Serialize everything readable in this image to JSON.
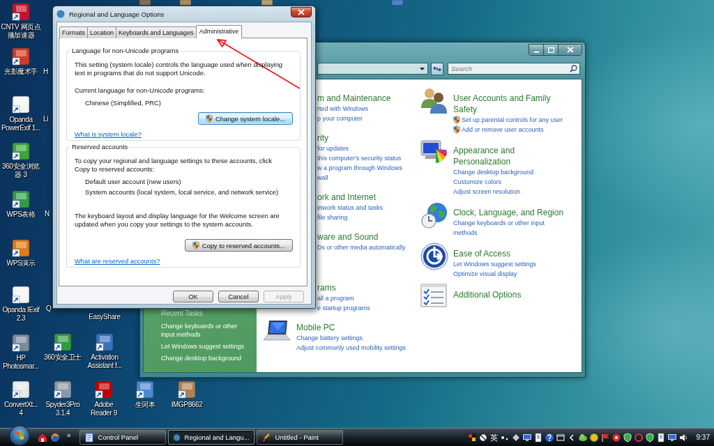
{
  "desktop": {
    "shortcuts": [
      {
        "kind": "full",
        "label": "CNTV 网页点播加速器"
      },
      {
        "kind": "full",
        "label": "光影魔术手"
      },
      {
        "kind": "full",
        "label": "Opanda PowerExif 1..."
      },
      {
        "kind": "full",
        "label": "360安全浏览器 3"
      },
      {
        "kind": "full",
        "label": "WPS表格"
      },
      {
        "kind": "full",
        "label": "WPS演示"
      },
      {
        "kind": "full",
        "label": "Opanda IExif 2.3"
      },
      {
        "kind": "full",
        "label": "HP Photosmar..."
      },
      {
        "kind": "full",
        "label": "ConvertXt... 4"
      },
      {
        "kind": "cut",
        "label": "H"
      },
      {
        "kind": "cut",
        "label": "Li"
      },
      {
        "kind": "cut",
        "label": "N"
      },
      {
        "kind": "cut",
        "label": "Q"
      },
      {
        "kind": "full",
        "label": "360安全卫士"
      },
      {
        "kind": "full",
        "label": "Spyder3Pro 3.1.4"
      },
      {
        "kind": "label_only",
        "label": "EasyShare"
      },
      {
        "kind": "full",
        "label": "Activation Assistant f..."
      },
      {
        "kind": "full",
        "label": "Adobe Reader 9"
      },
      {
        "kind": "full",
        "label": "生词本"
      },
      {
        "kind": "full",
        "label": "IMGP8662"
      },
      {
        "kind": "icon_only"
      },
      {
        "kind": "icon_only"
      },
      {
        "kind": "icon_only"
      },
      {
        "kind": "icon_only"
      }
    ]
  },
  "dialog": {
    "title": "Regional and Language Options",
    "tabs": [
      {
        "label": "Formats",
        "selected": false
      },
      {
        "label": "Location",
        "selected": false
      },
      {
        "label": "Keyboards and Languages",
        "selected": false
      },
      {
        "label": "Administrative",
        "selected": true
      }
    ],
    "groups": [
      {
        "title": "Language for non-Unicode programs",
        "items": [
          {
            "kind": "paragraph",
            "text": "This setting (system locale) controls the language used when displaying text in programs that do not support Unicode."
          },
          {
            "kind": "paragraph",
            "text": "Current language for non-Unicode programs:"
          },
          {
            "kind": "indented",
            "text": "Chinese (Simplified, PRC)"
          },
          {
            "kind": "button",
            "text": "Change system locale...",
            "admin_shield": true,
            "default": true
          },
          {
            "kind": "link",
            "text": "What is system locale?"
          }
        ]
      },
      {
        "title": "Reserved accounts",
        "items": [
          {
            "kind": "paragraph",
            "text": "To copy your regional and language settings to these accounts, click Copy to reserved accounts:"
          },
          {
            "kind": "indented",
            "text": "Default user account (new users)"
          },
          {
            "kind": "indented",
            "text": "System accounts (local system, local service, and network service)"
          },
          {
            "kind": "paragraph",
            "text": "The keyboard layout and display language for the Welcome screen are updated when you copy your settings to the system accounts."
          },
          {
            "kind": "button",
            "text": "Copy to reserved accounts...",
            "admin_shield": true,
            "default": false
          },
          {
            "kind": "link",
            "text": "What are reserved accounts?"
          }
        ]
      }
    ],
    "buttons": [
      {
        "label": "OK",
        "disabled": false
      },
      {
        "label": "Cancel",
        "disabled": false
      },
      {
        "label": "Apply",
        "disabled": true
      }
    ]
  },
  "control_panel": {
    "search": {
      "placeholder": "Search"
    },
    "recent_tasks": {
      "title": "Recent Tasks",
      "links": [
        "Change keyboards or other input methods",
        "Let Windows suggest settings",
        "Change desktop background"
      ]
    },
    "left_categories": [
      {
        "kind": "cut",
        "heading": "m and Maintenance",
        "links": [
          "rted with Windows",
          "p your computer"
        ]
      },
      {
        "kind": "cut",
        "heading": "rity",
        "links": [
          "for updates",
          "this computer's security status",
          "w a program through Windows",
          "wall"
        ]
      },
      {
        "kind": "cut",
        "heading": "ork and Internet",
        "links": [
          "etwork status and tasks",
          "file sharing"
        ]
      },
      {
        "kind": "cut",
        "heading": "ware and Sound",
        "links": [
          "Ds or other media automatically"
        ]
      },
      {
        "kind": "cut",
        "heading": "rams",
        "links": [
          "all a program",
          "e startup programs"
        ]
      },
      {
        "kind": "full",
        "heading": "Mobile PC",
        "links": [
          "Change battery settings",
          "Adjust commonly used mobility settings"
        ]
      }
    ],
    "right_categories": [
      {
        "heading": "User Accounts and Family Safety",
        "admin_shield": true,
        "links": [
          "Set up parental controls for any user",
          "Add or remove user accounts"
        ]
      },
      {
        "heading": "Appearance and Personalization",
        "admin_shield": false,
        "links": [
          "Change desktop background",
          "Customize colors",
          "Adjust screen resolution"
        ]
      },
      {
        "heading": "Clock, Language, and Region",
        "admin_shield": false,
        "links": [
          "Change keyboards or other input methods"
        ]
      },
      {
        "heading": "Ease of Access",
        "admin_shield": false,
        "links": [
          "Let Windows suggest settings",
          "Optimize visual display"
        ]
      },
      {
        "heading": "Additional Options"
      }
    ]
  },
  "taskbar": {
    "more": "»",
    "tasks": [
      {
        "label": "Control Panel",
        "selected": false
      },
      {
        "label": "Regional and Langu...",
        "selected": true
      },
      {
        "label": "Untitled - Paint",
        "selected": false
      }
    ],
    "ime": "英",
    "clock": "9:37"
  }
}
